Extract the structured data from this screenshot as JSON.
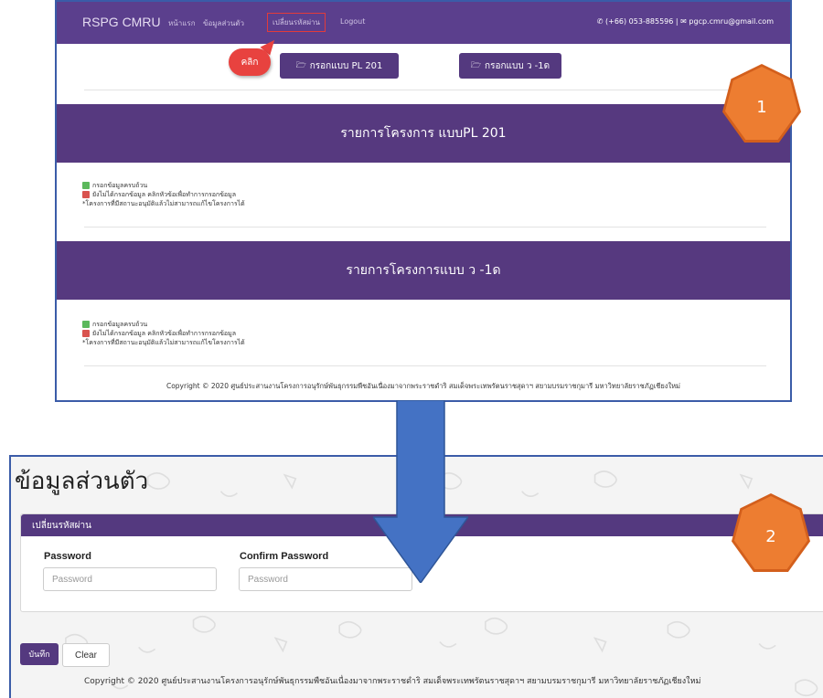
{
  "screen1": {
    "nav": {
      "brand": "RSPG CMRU",
      "links": [
        "หน้าแรก",
        "ข้อมูลส่วนตัว",
        "เปลี่ยนรหัสผ่าน",
        "Logout"
      ],
      "active_index": 2,
      "phone": "(+66) 053-885596",
      "email": "pgcp.cmru@gmail.com"
    },
    "buttons": {
      "pl201": "กรอกแบบ PL 201",
      "v1d": "กรอกแบบ ว -1ด"
    },
    "callout": "คลิก",
    "section1_title": "รายการโครงการ แบบPL 201",
    "section2_title": "รายการโครงการแบบ ว -1ด",
    "legend": {
      "complete": "กรอกข้อมูลครบถ้วน",
      "incomplete": "ยังไม่ได้กรอกข้อมูล คลิกหัวข้อเพื่อทำการกรอกข้อมูล",
      "note": "*โครงการที่มีสถานะอนุมัติแล้วไม่สามารถแก้ไขโครงการได้"
    },
    "footer": "Copyright © 2020 ศูนย์ประสานงานโครงการอนุรักษ์พันธุกรรมพืชอันเนื่องมาจากพระราชดำริ สมเด็จพระเทพรัตนราชสุดาฯ สยามบรมราชกุมารี มหาวิทยาลัยราชภัฏเชียงใหม่"
  },
  "badges": {
    "one": "1",
    "two": "2"
  },
  "screen2": {
    "title": "ข้อมูลส่วนตัว",
    "panel_title": "เปลี่ยนรหัสผ่าน",
    "password_label": "Password",
    "password_placeholder": "Password",
    "confirm_label": "Confirm Password",
    "confirm_placeholder": "Password",
    "save": "บันทึก",
    "clear": "Clear",
    "footer": "Copyright © 2020 ศูนย์ประสานงานโครงการอนุรักษ์พันธุกรรมพืชอันเนื่องมาจากพระราชดำริ สมเด็จพระเทพรัตนราชสุดาฯ สยามบรมราชกุมารี มหาวิทยาลัยราชภัฏเชียงใหม่"
  },
  "colors": {
    "purple": "#56397f",
    "badge_orange": "#ed7d31",
    "arrow_blue": "#4472c4",
    "callout_red": "#e8423f"
  }
}
